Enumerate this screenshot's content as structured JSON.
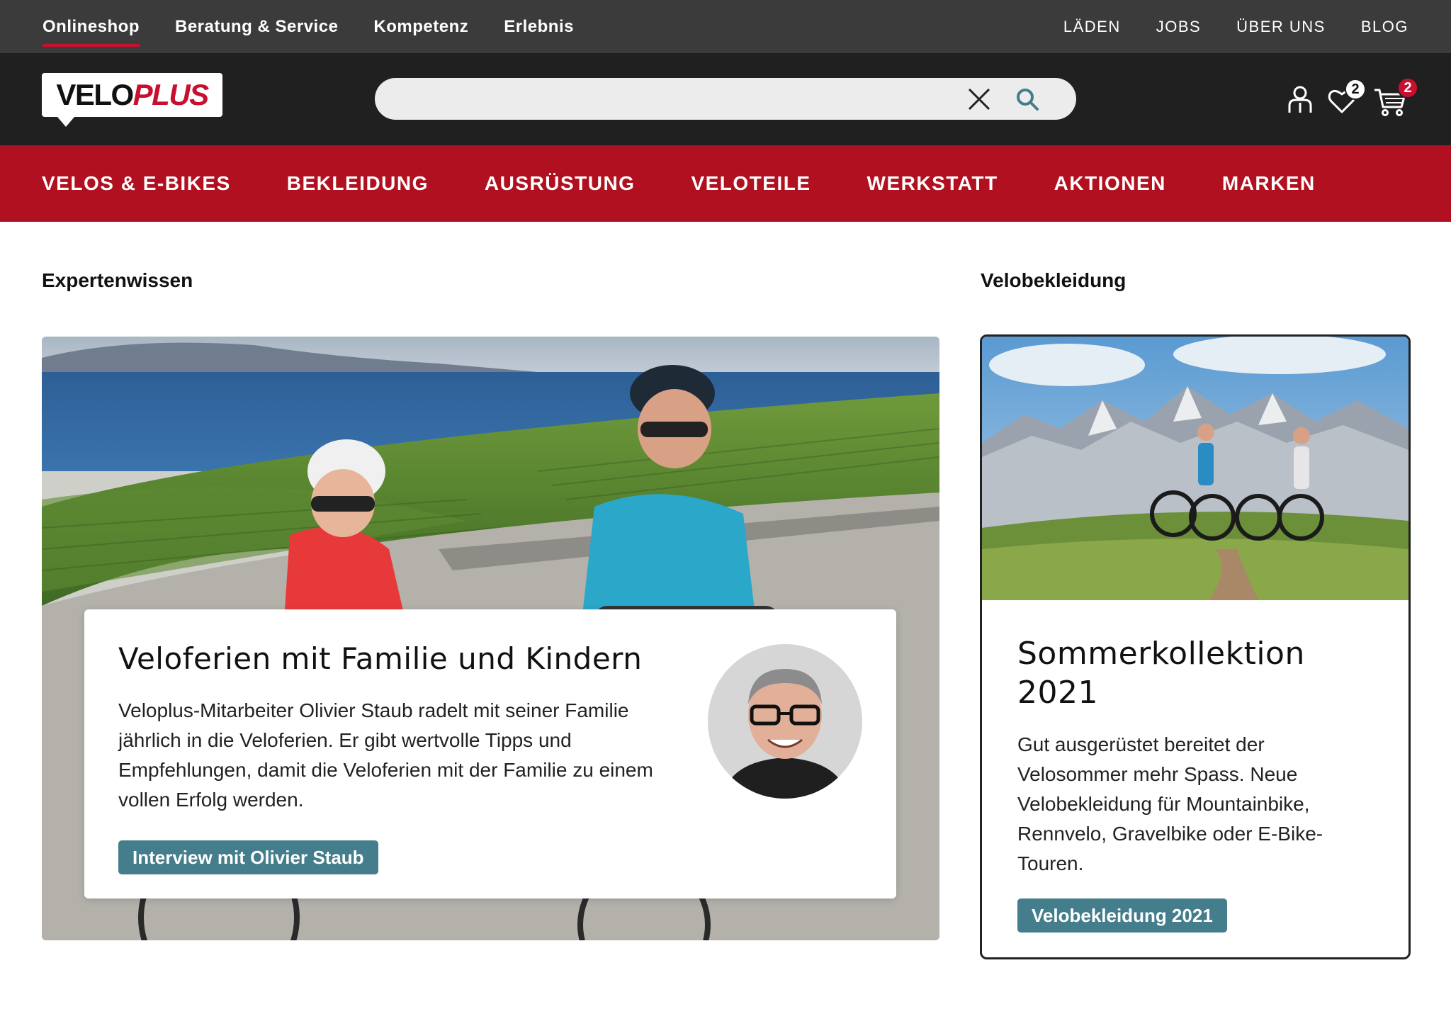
{
  "topbar": {
    "left": [
      "Onlineshop",
      "Beratung & Service",
      "Kompetenz",
      "Erlebnis"
    ],
    "right": [
      "LÄDEN",
      "JOBS",
      "ÜBER UNS",
      "BLOG"
    ]
  },
  "header": {
    "logo_velo": "VELO",
    "logo_plus": "PLUS",
    "search_value": "",
    "wishlist_count": "2",
    "cart_count": "2"
  },
  "mainnav": [
    "VELOS & E-BIKES",
    "BEKLEIDUNG",
    "AUSRÜSTUNG",
    "VELOTEILE",
    "WERKSTATT",
    "AKTIONEN",
    "MARKEN"
  ],
  "left_section": {
    "title": "Expertenwissen",
    "card_title": "Veloferien mit Familie und Kindern",
    "card_text": "Veloplus-Mitarbeiter Olivier Staub radelt mit seiner Familie jährlich in die Veloferien. Er gibt wertvolle Tipps und Empfehlungen, damit die Veloferien mit der Familie zu einem vollen Erfolg werden.",
    "button": "Interview mit Olivier Staub"
  },
  "right_section": {
    "title": "Velobekleidung",
    "card_title": "Sommerkollektion 2021",
    "card_text": "Gut ausgerüstet bereitet der Velosommer mehr Spass. Neue Velobekleidung für Mountainbike, Rennvelo, Gravelbike oder E-Bike-Touren.",
    "button": "Velobekleidung 2021"
  },
  "colors": {
    "topbar": "#3b3b3b",
    "header": "#202020",
    "nav": "#b0101f",
    "accent": "#c8102e",
    "button": "#447d8c"
  }
}
